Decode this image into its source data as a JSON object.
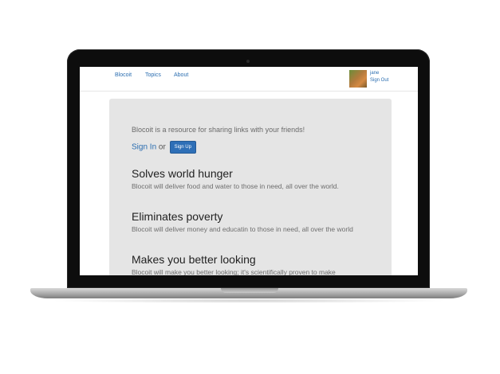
{
  "nav": {
    "links": [
      "Blocoit",
      "Topics",
      "About"
    ],
    "user_name": "jane",
    "sign_out": "Sign Out"
  },
  "hero": {
    "tagline": "Blocoit is a resource for sharing links with your friends!",
    "sign_in": "Sign In",
    "or_text": "or",
    "sign_up": "Sign Up"
  },
  "features": [
    {
      "title": "Solves world hunger",
      "text": "Blocoit will deliver food and water to those in need, all over the world."
    },
    {
      "title": "Eliminates poverty",
      "text": "Blocoit will deliver money and educatin to those in need, all over the world"
    },
    {
      "title": "Makes you better looking",
      "text": "Blocoit will make you better looking; it's scientifically proven to make"
    }
  ]
}
